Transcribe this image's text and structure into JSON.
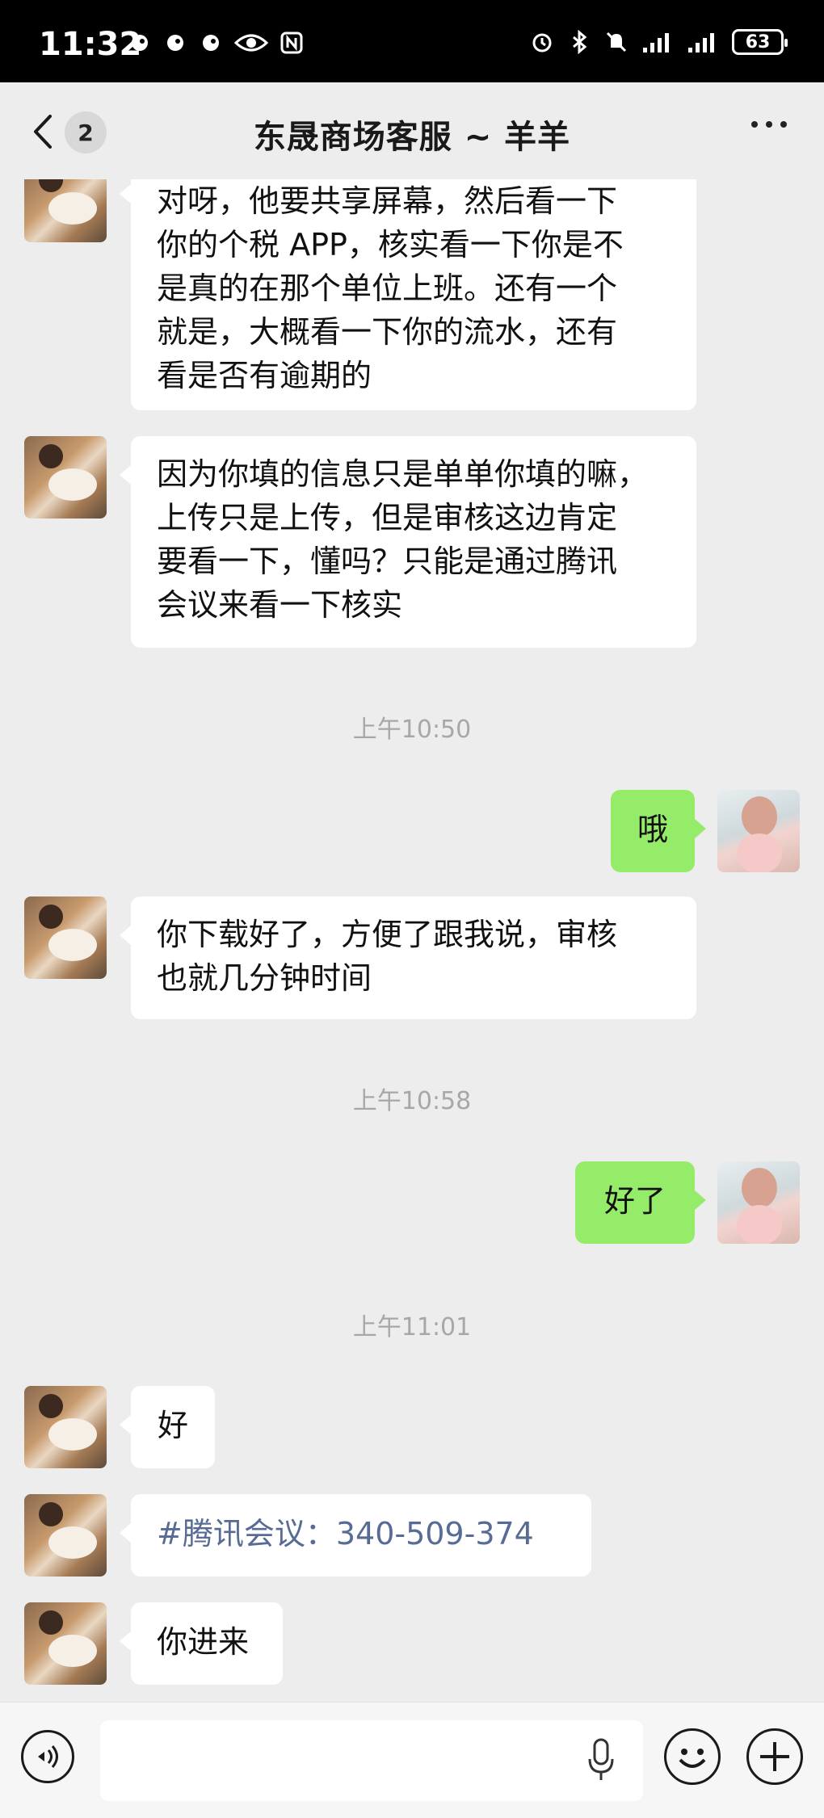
{
  "status_bar": {
    "time": "11:32",
    "battery": "63",
    "left_icons": [
      "notification-icon",
      "notification-icon",
      "notification-icon",
      "eye-icon",
      "nfc-icon"
    ],
    "right_icons": [
      "alarm-icon",
      "bluetooth-icon",
      "mute-icon",
      "signal-icon",
      "signal-icon",
      "battery-icon"
    ]
  },
  "nav": {
    "title": "东晟商场客服 ~ 羊羊",
    "unread_count": "2",
    "back_icon": "chevron-left-icon",
    "more_icon": "more-icon"
  },
  "messages": [
    {
      "side": "in",
      "lines": [
        "对呀，他要共享屏幕，然后看一下",
        "你的个税 APP，核实看一下你是不",
        "是真的在那个单位上班。还有一个",
        "就是，大概看一下你的流水，还有",
        "看是否有逾期的"
      ]
    },
    {
      "side": "in",
      "lines": [
        "因为你填的信息只是单单你填的嘛，",
        "上传只是上传，但是审核这边肯定",
        "要看一下，懂吗？只能是通过腾讯",
        "会议来看一下核实"
      ]
    },
    {
      "type": "time",
      "text": "上午10:50"
    },
    {
      "side": "out",
      "text": "哦"
    },
    {
      "side": "in",
      "lines": [
        "你下载好了，方便了跟我说，审核",
        "也就几分钟时间"
      ]
    },
    {
      "type": "time",
      "text": "上午10:58"
    },
    {
      "side": "out",
      "text": "好了"
    },
    {
      "type": "time",
      "text": "上午11:01"
    },
    {
      "side": "in",
      "text": "好"
    },
    {
      "side": "in",
      "text": "#腾讯会议：340-509-374",
      "is_link": true
    },
    {
      "side": "in",
      "text": "你进来"
    }
  ],
  "input_bar": {
    "value": "",
    "icons": [
      "voice-icon",
      "mic-icon",
      "emoji-icon",
      "plus-icon"
    ]
  },
  "colors": {
    "background": "#ededed",
    "outgoing_bubble": "#95ec69",
    "incoming_bubble": "#ffffff",
    "link": "#576b95",
    "timestamp": "#a7a7a7"
  }
}
